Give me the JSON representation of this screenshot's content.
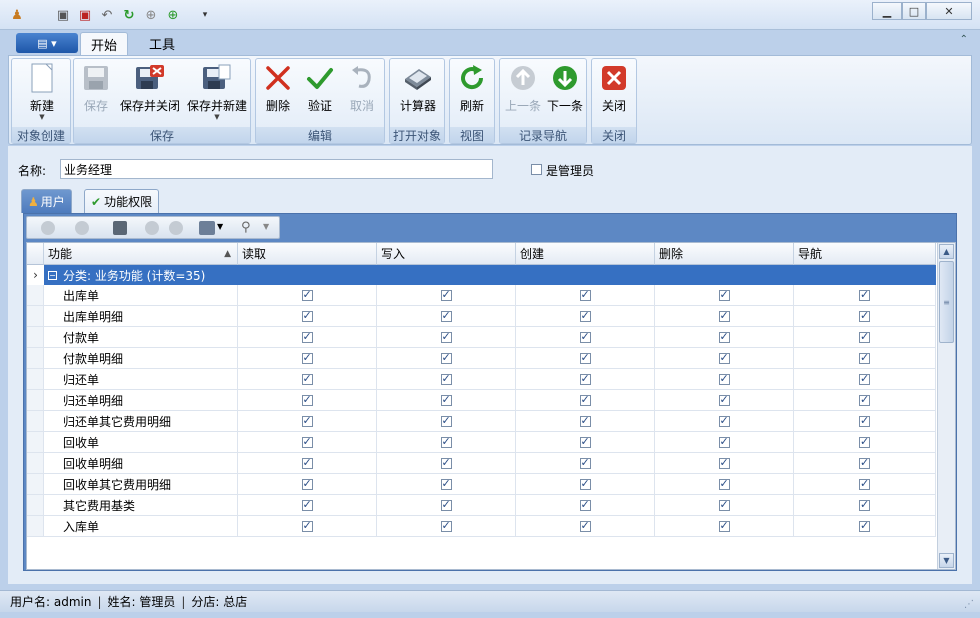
{
  "colors": {
    "accent": "#3670c2",
    "ribbon_bg": "#dbe7f5",
    "window_bg": "#bcd0ea"
  },
  "quick_access": [
    "app-icon",
    "save-icon",
    "save-close-icon",
    "undo-icon",
    "refresh-icon",
    "up-icon",
    "down-icon"
  ],
  "window_controls": {
    "minimize": "▁",
    "maximize": "□",
    "close": "✕"
  },
  "ribbon_tabs": [
    {
      "label": "开始",
      "active": true
    },
    {
      "label": "工具",
      "active": false
    }
  ],
  "ribbon_groups": [
    {
      "label": "对象创建",
      "buttons": [
        {
          "label": "新建",
          "icon": "new-doc-icon",
          "enabled": true,
          "dropdown": true
        }
      ]
    },
    {
      "label": "保存",
      "buttons": [
        {
          "label": "保存",
          "icon": "save-icon",
          "enabled": false
        },
        {
          "label": "保存并关闭",
          "icon": "save-close-icon",
          "enabled": true
        },
        {
          "label": "保存并新建",
          "icon": "save-new-icon",
          "enabled": true,
          "dropdown": true
        }
      ]
    },
    {
      "label": "编辑",
      "buttons": [
        {
          "label": "删除",
          "icon": "delete-icon",
          "enabled": true
        },
        {
          "label": "验证",
          "icon": "validate-icon",
          "enabled": true
        },
        {
          "label": "取消",
          "icon": "cancel-icon",
          "enabled": false
        }
      ]
    },
    {
      "label": "打开对象",
      "buttons": [
        {
          "label": "计算器",
          "icon": "calculator-icon",
          "enabled": true
        }
      ]
    },
    {
      "label": "视图",
      "buttons": [
        {
          "label": "刷新",
          "icon": "refresh-icon",
          "enabled": true
        }
      ]
    },
    {
      "label": "记录导航",
      "buttons": [
        {
          "label": "上一条",
          "icon": "previous-icon",
          "enabled": false
        },
        {
          "label": "下一条",
          "icon": "next-icon",
          "enabled": true
        }
      ]
    },
    {
      "label": "关闭",
      "buttons": [
        {
          "label": "关闭",
          "icon": "close-icon",
          "enabled": true
        }
      ]
    }
  ],
  "form": {
    "name_label": "名称:",
    "name_value": "业务经理",
    "is_admin_label": "是管理员",
    "is_admin_checked": false
  },
  "inner_tabs": [
    {
      "label": "用户",
      "active": false,
      "icon": "users-icon"
    },
    {
      "label": "功能权限",
      "active": true,
      "icon": "permission-icon"
    }
  ],
  "grid": {
    "columns": [
      "功能",
      "读取",
      "写入",
      "创建",
      "删除",
      "导航"
    ],
    "sort_indicator": "▲",
    "group_row": "分类: 业务功能 (计数=35)",
    "rows": [
      {
        "name": "出库单",
        "read": true,
        "write": true,
        "create": true,
        "delete": true,
        "nav": true
      },
      {
        "name": "出库单明细",
        "read": true,
        "write": true,
        "create": true,
        "delete": true,
        "nav": true
      },
      {
        "name": "付款单",
        "read": true,
        "write": true,
        "create": true,
        "delete": true,
        "nav": true
      },
      {
        "name": "付款单明细",
        "read": true,
        "write": true,
        "create": true,
        "delete": true,
        "nav": true
      },
      {
        "name": "归还单",
        "read": true,
        "write": true,
        "create": true,
        "delete": true,
        "nav": true
      },
      {
        "name": "归还单明细",
        "read": true,
        "write": true,
        "create": true,
        "delete": true,
        "nav": true
      },
      {
        "name": "归还单其它费用明细",
        "read": true,
        "write": true,
        "create": true,
        "delete": true,
        "nav": true
      },
      {
        "name": "回收单",
        "read": true,
        "write": true,
        "create": true,
        "delete": true,
        "nav": true
      },
      {
        "name": "回收单明细",
        "read": true,
        "write": true,
        "create": true,
        "delete": true,
        "nav": true
      },
      {
        "name": "回收单其它费用明细",
        "read": true,
        "write": true,
        "create": true,
        "delete": true,
        "nav": true
      },
      {
        "name": "其它费用基类",
        "read": true,
        "write": true,
        "create": true,
        "delete": true,
        "nav": true
      },
      {
        "name": "入库单",
        "read": true,
        "write": true,
        "create": true,
        "delete": true,
        "nav": true
      }
    ]
  },
  "status": {
    "username": "用户名: admin",
    "fullname": "姓名: 管理员",
    "branch": "分店: 总店",
    "separator": "|"
  }
}
